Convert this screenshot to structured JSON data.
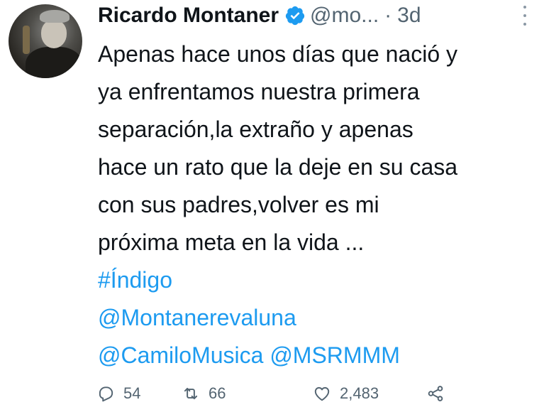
{
  "author": {
    "name": "Ricardo Montaner",
    "handle": "@mo...",
    "separator": "·",
    "time": "3d",
    "verified_color": "#1d9bf0"
  },
  "tweet": {
    "lines": [
      "Apenas hace unos días que nació y",
      "ya enfrentamos nuestra primera",
      "separación,la extraño y apenas",
      "hace un rato que la deje en su casa",
      "con sus padres,volver es mi",
      "próxima meta en la vida ..."
    ],
    "hashtag": "#Índigo",
    "mentions": [
      "@Montanerevaluna",
      "@CamiloMusica @MSRMMM"
    ]
  },
  "actions": {
    "replies": "54",
    "retweets": "66",
    "likes": "2,483"
  },
  "colors": {
    "link": "#1d9bf0",
    "secondary_text": "#536471"
  }
}
